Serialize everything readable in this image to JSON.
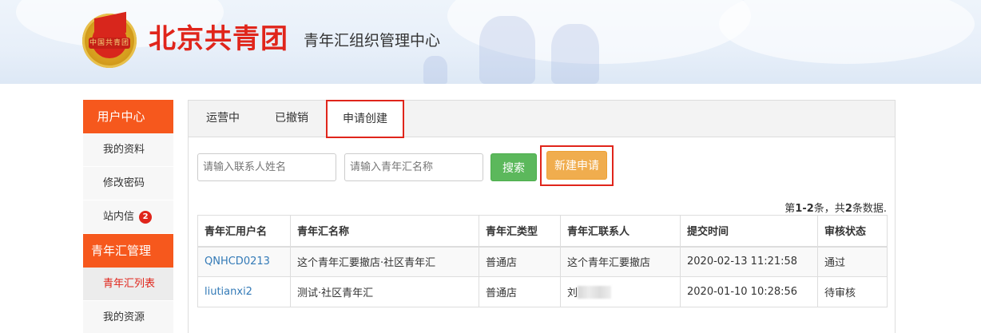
{
  "header": {
    "badge_text": "中国共青团",
    "brand": "北京共青团",
    "subtitle": "青年汇组织管理中心"
  },
  "sidebar": {
    "sections": [
      {
        "title": "用户中心",
        "items": [
          {
            "label": "我的资料"
          },
          {
            "label": "修改密码"
          },
          {
            "label": "站内信",
            "badge": "2"
          }
        ]
      },
      {
        "title": "青年汇管理",
        "items": [
          {
            "label": "青年汇列表",
            "active": true
          },
          {
            "label": "我的资源"
          }
        ]
      }
    ]
  },
  "tabs": [
    {
      "label": "运营中"
    },
    {
      "label": "已撤销"
    },
    {
      "label": "申请创建",
      "active": true
    }
  ],
  "search": {
    "contact_placeholder": "请输入联系人姓名",
    "name_placeholder": "请输入青年汇名称",
    "search_label": "搜索",
    "new_label": "新建申请"
  },
  "summary": {
    "prefix": "第",
    "range": "1-2",
    "middle": "条，共",
    "total": "2",
    "suffix": "条数据."
  },
  "table": {
    "headers": [
      "青年汇用户名",
      "青年汇名称",
      "青年汇类型",
      "青年汇联系人",
      "提交时间",
      "审核状态"
    ],
    "rows": [
      [
        "QNHCD0213",
        "这个青年汇要撤店·社区青年汇",
        "普通店",
        "这个青年汇要撤店",
        "2020-02-13 11:21:58",
        "通过"
      ],
      [
        "liutianxi2",
        "测试·社区青年汇",
        "普通店",
        "刘",
        "2020-01-10 10:28:56",
        "待审核"
      ]
    ]
  }
}
